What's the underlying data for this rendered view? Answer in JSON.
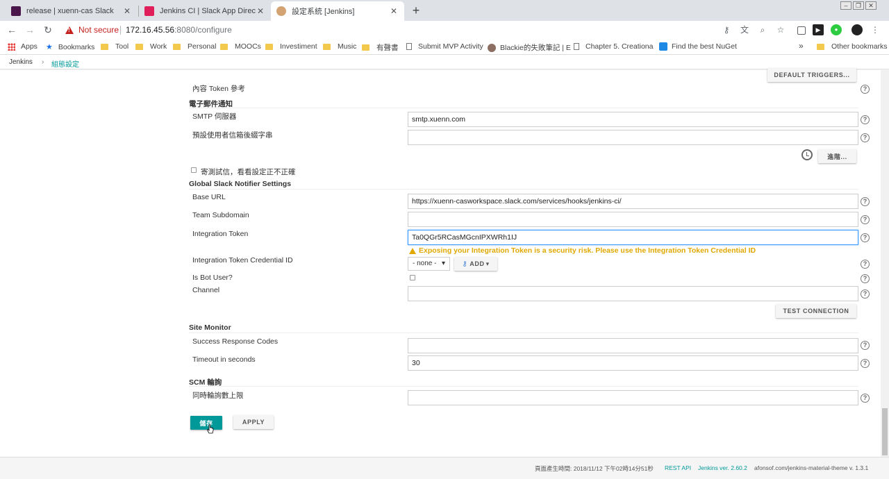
{
  "browser": {
    "tabs": [
      {
        "title": "release | xuenn-cas Slack",
        "favicon_color": "#4a154b"
      },
      {
        "title": "Jenkins CI | Slack App Directory",
        "favicon_color": "#e01e5a"
      },
      {
        "title": "設定系統 [Jenkins]",
        "favicon_color": "#d4a373"
      }
    ],
    "new_tab": "+",
    "close_glyph": "✕",
    "security_label": "Not secure",
    "url_host": "172.16.45.56",
    "url_rest": ":8080/configure",
    "bookmarks": [
      {
        "label": "Apps",
        "icon": "apps-grid-icon"
      },
      {
        "label": "Bookmarks",
        "icon": "star-icon"
      },
      {
        "label": "Tool",
        "icon": "folder-icon"
      },
      {
        "label": "Work",
        "icon": "folder-icon"
      },
      {
        "label": "Personal",
        "icon": "folder-icon"
      },
      {
        "label": "MOOCs",
        "icon": "folder-icon"
      },
      {
        "label": "Investiment",
        "icon": "folder-icon"
      },
      {
        "label": "Music",
        "icon": "folder-icon"
      },
      {
        "label": "有聲書",
        "icon": "folder-icon"
      },
      {
        "label": "Submit MVP Activity",
        "icon": "page-icon"
      },
      {
        "label": "Blackie的失敗筆記 | E",
        "icon": "avatar-icon"
      },
      {
        "label": "Chapter 5. Creationa",
        "icon": "page-icon"
      },
      {
        "label": "Find the best NuGet",
        "icon": "nuget-icon"
      }
    ],
    "overflow": "»",
    "other_bookmarks": "Other bookmarks"
  },
  "breadcrumb": {
    "root": "Jenkins",
    "separator": "›",
    "current": "組態設定"
  },
  "form": {
    "default_triggers_button": "DEFAULT TRIGGERS...",
    "content_token_label": "內容 Token 參考",
    "email_section": "電子郵件通知",
    "smtp_label": "SMTP 伺服器",
    "smtp_value": "smtp.xuenn.com",
    "suffix_label": "預設使用者信箱後綴字串",
    "suffix_value": "",
    "advanced_button": "進階...",
    "test_mail_label": "寄測試信，看看設定正不正確",
    "slack_section": "Global Slack Notifier Settings",
    "base_url_label": "Base URL",
    "base_url_value": "https://xuenn-casworkspace.slack.com/services/hooks/jenkins-ci/",
    "team_label": "Team Subdomain",
    "team_value": "",
    "token_label": "Integration Token",
    "token_value": "Ta0QGr5RCasMGcnIPXWRh1IJ",
    "token_warning": "Exposing your Integration Token is a security risk. Please use the Integration Token Credential ID",
    "credential_label": "Integration Token Credential ID",
    "credential_select": "- none -",
    "credential_arrow": "▾",
    "add_button": "ADD",
    "bot_label": "Is Bot User?",
    "channel_label": "Channel",
    "channel_value": "",
    "test_connection_button": "TEST CONNECTION",
    "site_monitor_section": "Site Monitor",
    "success_codes_label": "Success Response Codes",
    "success_codes_value": "",
    "timeout_label": "Timeout in seconds",
    "timeout_value": "30",
    "scm_section": "SCM 輪詢",
    "scm_max_label": "同時輪詢數上限",
    "scm_max_value": "",
    "help_glyph": "?",
    "save_button": "儲存",
    "apply_button": "APPLY"
  },
  "footer": {
    "generated": "頁面產生時間: 2018/11/12 下午02時14分51秒",
    "rest_api": "REST API",
    "version": "Jenkins ver. 2.60.2",
    "theme": "afonsof.com/jenkins-material-theme v. 1.3.1"
  },
  "colors": {
    "accent": "#009999",
    "warning": "#e0a800",
    "insecure": "#c5221f"
  }
}
